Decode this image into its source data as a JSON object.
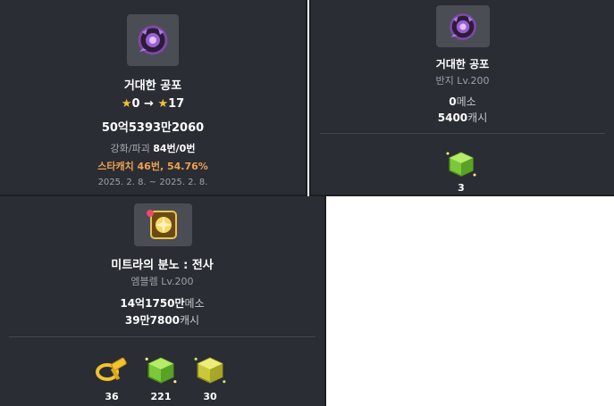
{
  "card1": {
    "item_icon": "dark-ring-icon",
    "item_name": "거대한 공포",
    "star_from": "0",
    "arrow": "→",
    "star_to": "17",
    "cost": "50억5393만2060",
    "enhance_label": "강화/파괴",
    "enhance_value": "84번/0번",
    "starcatch": "스타캐치 46번, 54.76%",
    "date_range": "2025. 2. 8. ~ 2025. 2. 8."
  },
  "card2": {
    "item_icon": "dark-ring-icon",
    "item_name": "거대한 공포",
    "item_type": "반지 Lv.200",
    "meso_value": "0",
    "meso_unit": "메소",
    "cash_value": "5400",
    "cash_unit": "캐시",
    "rewards": [
      {
        "icon": "green-cube-icon",
        "count": "3"
      }
    ]
  },
  "card3": {
    "item_icon": "emblem-icon",
    "item_name": "미트라의 분노 : 전사",
    "item_type": "엠블렘 Lv.200",
    "meso_value": "14억1750만",
    "meso_unit": "메소",
    "cash_value": "39만7800",
    "cash_unit": "캐시",
    "rewards": [
      {
        "icon": "gold-hammer-icon",
        "count": "36"
      },
      {
        "icon": "green-cube-icon",
        "count": "221"
      },
      {
        "icon": "yellow-cube-icon",
        "count": "30"
      }
    ]
  },
  "colors": {
    "card_bg": "#2a2d33",
    "accent_orange": "#f0a050",
    "star_yellow": "#f2c230"
  }
}
